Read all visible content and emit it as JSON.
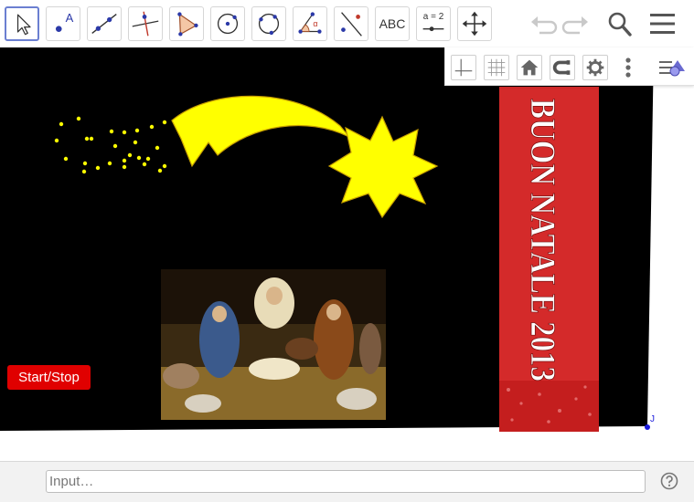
{
  "toolbar": {
    "tools": [
      {
        "name": "move-tool",
        "icon": "cursor-arrow-icon"
      },
      {
        "name": "point-tool",
        "icon": "point-icon",
        "label": "A"
      },
      {
        "name": "line-tool",
        "icon": "line-through-points-icon"
      },
      {
        "name": "perpendicular-tool",
        "icon": "perpendicular-line-icon"
      },
      {
        "name": "polygon-tool",
        "icon": "polygon-icon"
      },
      {
        "name": "circle-center-tool",
        "icon": "circle-center-point-icon"
      },
      {
        "name": "circle-three-points-tool",
        "icon": "circle-three-points-icon"
      },
      {
        "name": "angle-tool",
        "icon": "angle-icon",
        "label": "α"
      },
      {
        "name": "reflect-tool",
        "icon": "reflect-line-icon"
      },
      {
        "name": "text-tool",
        "icon": "text-icon",
        "label": "ABC"
      },
      {
        "name": "slider-tool",
        "icon": "slider-icon",
        "label": "a = 2"
      },
      {
        "name": "move-graphics-tool",
        "icon": "move-graphics-icon"
      }
    ],
    "undo_icon": "undo-icon",
    "redo_icon": "redo-icon",
    "search_icon": "search-icon",
    "menu_icon": "hamburger-menu-icon"
  },
  "style_bar": {
    "buttons": [
      "axes-icon",
      "grid-icon",
      "home-icon",
      "point-capturing-icon",
      "settings-gear-icon",
      "more-vertical-icon"
    ],
    "toggle_icon": "style-bar-toggle-icon"
  },
  "graphics": {
    "start_stop_label": "Start/Stop",
    "point_label": "J",
    "banner_text": "BUON NATALE 2013",
    "colors": {
      "background": "#000000",
      "star": "#ffff00",
      "banner": "#d42a2a",
      "button": "#e00000",
      "point": "#1a1adc"
    }
  },
  "input_bar": {
    "placeholder": "Input…",
    "help_icon": "help-icon"
  }
}
